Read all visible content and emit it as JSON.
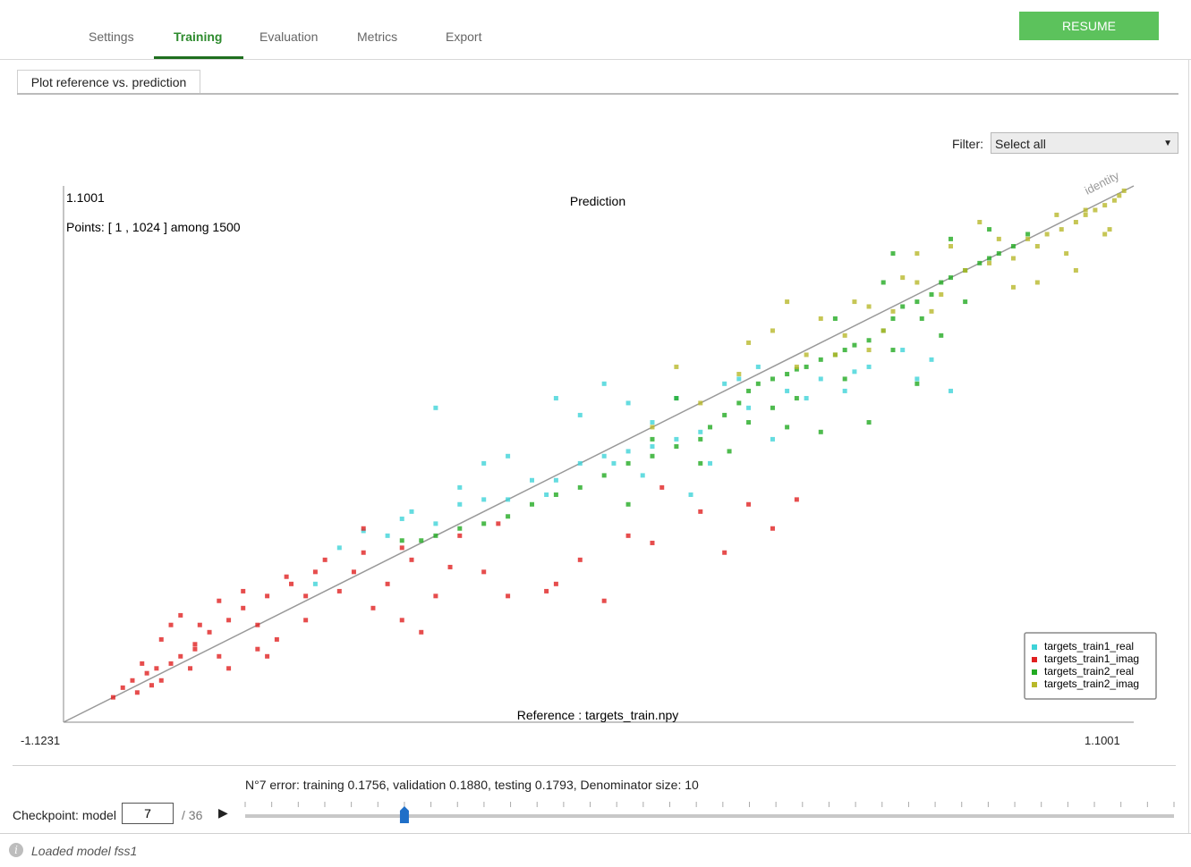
{
  "tabs": [
    {
      "label": "Settings",
      "active": false
    },
    {
      "label": "Training",
      "active": true
    },
    {
      "label": "Evaluation",
      "active": false
    },
    {
      "label": "Metrics",
      "active": false
    },
    {
      "label": "Export",
      "active": false
    }
  ],
  "resume_label": "RESUME",
  "subtab_label": "Plot reference vs. prediction",
  "filter": {
    "label": "Filter:",
    "value": "Select all"
  },
  "chart_data": {
    "type": "scatter",
    "title": "Prediction",
    "xlabel": "Reference : targets_train.npy",
    "ylabel": "",
    "y_top_label": "1.1001",
    "x_min_label": "-1.1231",
    "x_max_label": "1.1001",
    "xlim": [
      -1.1231,
      1.1001
    ],
    "ylim": [
      -1.1231,
      1.1001
    ],
    "points_info": "Points: [ 1 , 1024 ] among 1500",
    "identity_label": "identity",
    "legend_position": "bottom-right",
    "series": [
      {
        "name": "targets_train1_real",
        "color": "#3fd3d8",
        "x": [
          -0.55,
          -0.5,
          -0.45,
          -0.4,
          -0.35,
          -0.3,
          -0.25,
          -0.2,
          -0.15,
          -0.1,
          -0.05,
          0.0,
          0.05,
          0.1,
          0.15,
          0.2,
          -0.42,
          -0.3,
          -0.12,
          0.02,
          0.1,
          0.25,
          0.32,
          0.38,
          0.45,
          0.52,
          0.62,
          0.68,
          0.72,
          0.35,
          0.05,
          -0.2,
          -0.05,
          0.15,
          0.28,
          0.5,
          -0.35,
          0.08,
          0.18,
          -0.6,
          -0.25,
          0.0,
          0.42,
          0.55,
          0.65,
          -0.1,
          0.22,
          0.3
        ],
        "y": [
          -0.4,
          -0.33,
          -0.35,
          -0.25,
          -0.3,
          -0.22,
          -0.2,
          -0.2,
          -0.12,
          -0.12,
          -0.05,
          -0.02,
          0.0,
          0.02,
          0.05,
          0.08,
          -0.28,
          -0.15,
          -0.18,
          -0.05,
          0.12,
          0.28,
          0.35,
          0.25,
          0.3,
          0.33,
          0.42,
          0.38,
          0.25,
          0.05,
          0.2,
          -0.02,
          0.15,
          0.22,
          0.3,
          0.25,
          0.18,
          -0.1,
          -0.18,
          -0.55,
          -0.05,
          0.28,
          0.22,
          0.35,
          0.3,
          0.22,
          -0.05,
          0.18
        ]
      },
      {
        "name": "targets_train1_imag",
        "color": "#e02020",
        "x": [
          -1.02,
          -1.0,
          -0.98,
          -0.97,
          -0.95,
          -0.94,
          -0.93,
          -0.92,
          -0.9,
          -0.88,
          -0.86,
          -0.85,
          -0.82,
          -0.8,
          -0.78,
          -0.75,
          -0.72,
          -0.7,
          -0.68,
          -0.65,
          -0.62,
          -0.6,
          -0.58,
          -0.55,
          -0.52,
          -0.5,
          -0.48,
          -0.45,
          -0.42,
          -0.4,
          -0.38,
          -0.35,
          -0.3,
          -0.25,
          -0.2,
          -0.1,
          -0.05,
          0.0,
          0.1,
          0.2,
          0.3,
          0.35,
          0.4,
          -0.9,
          -0.85,
          -0.8,
          -0.75,
          -0.7,
          -0.96,
          -0.92,
          -0.88,
          -0.84,
          -0.78,
          -0.72,
          -0.66,
          -0.62,
          -0.5,
          -0.42,
          -0.32,
          -0.22,
          -0.12,
          0.05,
          0.12,
          0.25
        ],
        "y": [
          -1.02,
          -0.98,
          -0.95,
          -1.0,
          -0.92,
          -0.97,
          -0.9,
          -0.95,
          -0.88,
          -0.85,
          -0.9,
          -0.8,
          -0.75,
          -0.85,
          -0.7,
          -0.65,
          -0.72,
          -0.6,
          -0.78,
          -0.55,
          -0.6,
          -0.5,
          -0.45,
          -0.58,
          -0.5,
          -0.42,
          -0.65,
          -0.55,
          -0.7,
          -0.45,
          -0.75,
          -0.6,
          -0.35,
          -0.5,
          -0.6,
          -0.55,
          -0.45,
          -0.62,
          -0.38,
          -0.25,
          -0.22,
          -0.32,
          -0.2,
          -0.72,
          -0.82,
          -0.62,
          -0.58,
          -0.85,
          -0.88,
          -0.78,
          -0.68,
          -0.72,
          -0.9,
          -0.82,
          -0.52,
          -0.7,
          -0.32,
          -0.4,
          -0.48,
          -0.3,
          -0.58,
          -0.35,
          -0.15,
          -0.42
        ]
      },
      {
        "name": "targets_train2_real",
        "color": "#22aa22",
        "x": [
          -0.42,
          -0.38,
          -0.35,
          -0.3,
          -0.25,
          -0.2,
          -0.15,
          -0.1,
          -0.05,
          0.0,
          0.05,
          0.1,
          0.15,
          0.2,
          0.22,
          0.25,
          0.28,
          0.3,
          0.32,
          0.35,
          0.38,
          0.4,
          0.42,
          0.45,
          0.48,
          0.5,
          0.52,
          0.55,
          0.58,
          0.6,
          0.62,
          0.65,
          0.68,
          0.7,
          0.72,
          0.75,
          0.78,
          0.8,
          0.82,
          0.85,
          0.88,
          0.3,
          0.35,
          0.4,
          0.45,
          0.5,
          0.55,
          0.6,
          0.65,
          0.7,
          0.2,
          0.15,
          0.1,
          0.05,
          0.75,
          0.58,
          0.48,
          0.38,
          0.26,
          0.6,
          0.66,
          0.72,
          0.8
        ],
        "y": [
          -0.37,
          -0.37,
          -0.35,
          -0.32,
          -0.3,
          -0.27,
          -0.22,
          -0.18,
          -0.15,
          -0.1,
          -0.05,
          -0.02,
          0.02,
          0.05,
          0.1,
          0.15,
          0.2,
          0.25,
          0.28,
          0.3,
          0.32,
          0.34,
          0.35,
          0.38,
          0.4,
          0.42,
          0.44,
          0.46,
          0.5,
          0.55,
          0.6,
          0.62,
          0.65,
          0.7,
          0.72,
          0.75,
          0.78,
          0.8,
          0.82,
          0.85,
          0.9,
          0.12,
          0.18,
          0.22,
          0.08,
          0.3,
          0.12,
          0.42,
          0.28,
          0.48,
          -0.05,
          0.22,
          0.05,
          -0.22,
          0.62,
          0.7,
          0.55,
          0.1,
          0.0,
          0.82,
          0.55,
          0.88,
          0.92
        ]
      },
      {
        "name": "targets_train2_imag",
        "color": "#b8b82a",
        "x": [
          0.28,
          0.35,
          0.4,
          0.45,
          0.5,
          0.55,
          0.6,
          0.65,
          0.7,
          0.75,
          0.8,
          0.85,
          0.88,
          0.9,
          0.92,
          0.95,
          0.98,
          1.0,
          1.02,
          1.04,
          1.06,
          1.07,
          1.08,
          0.3,
          0.42,
          0.52,
          0.62,
          0.72,
          0.82,
          0.9,
          0.96,
          1.0,
          1.05,
          0.85,
          0.78,
          0.68,
          0.58,
          0.48,
          0.38,
          0.2,
          0.15,
          0.1,
          0.55,
          0.65,
          0.98,
          1.04,
          0.94
        ],
        "y": [
          0.32,
          0.5,
          0.35,
          0.55,
          0.48,
          0.6,
          0.58,
          0.7,
          0.65,
          0.75,
          0.78,
          0.8,
          0.88,
          0.85,
          0.9,
          0.92,
          0.95,
          0.98,
          1.0,
          1.02,
          1.04,
          1.06,
          1.08,
          0.45,
          0.4,
          0.62,
          0.72,
          0.85,
          0.88,
          0.7,
          0.82,
          1.0,
          0.92,
          0.68,
          0.95,
          0.58,
          0.5,
          0.4,
          0.62,
          0.2,
          0.35,
          0.1,
          0.42,
          0.82,
          0.75,
          0.9,
          0.98
        ]
      }
    ]
  },
  "error_text": "N°7 error: training 0.1756, validation 0.1880, testing 0.1793, Denominator size: 10",
  "checkpoint": {
    "label": "Checkpoint: model",
    "value": "7",
    "total": "/ 36",
    "current": 7,
    "count": 36
  },
  "status": "Loaded model fss1"
}
